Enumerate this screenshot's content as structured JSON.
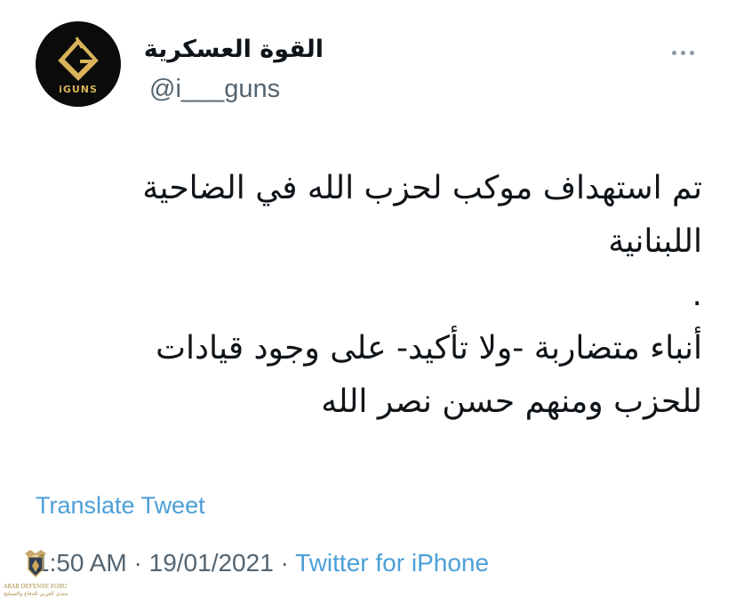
{
  "author": {
    "display_name": "القوة العسكرية",
    "handle": "@i___guns",
    "avatar_brand": "iGUNS"
  },
  "tweet": {
    "lines": [
      "تم استهداف موكب لحزب الله في الضاحية",
      "اللبنانية",
      ".",
      "أنباء متضاربة -ولا تأكيد- على وجود قيادات",
      "للحزب ومنهم حسن نصر الله"
    ],
    "translate_label": "Translate Tweet"
  },
  "meta": {
    "time": "1:50 AM",
    "separator1": " · ",
    "date": "19/01/2021",
    "separator2": " · ",
    "source": "Twitter for iPhone"
  },
  "watermark": {
    "line1": "ARAB DEFENSE FORUM",
    "line2": "المنتدى العربي للدفاع والتسليح"
  },
  "icons": {
    "more": "more-horizontal-icon",
    "avatar_logo": "iguns-logo-icon",
    "watermark": "eagle-shield-icon"
  },
  "colors": {
    "link": "#4b9fd8",
    "secondary_text": "#536471",
    "avatar_bg": "#0b0b0b",
    "avatar_gold": "#d8b35a"
  }
}
